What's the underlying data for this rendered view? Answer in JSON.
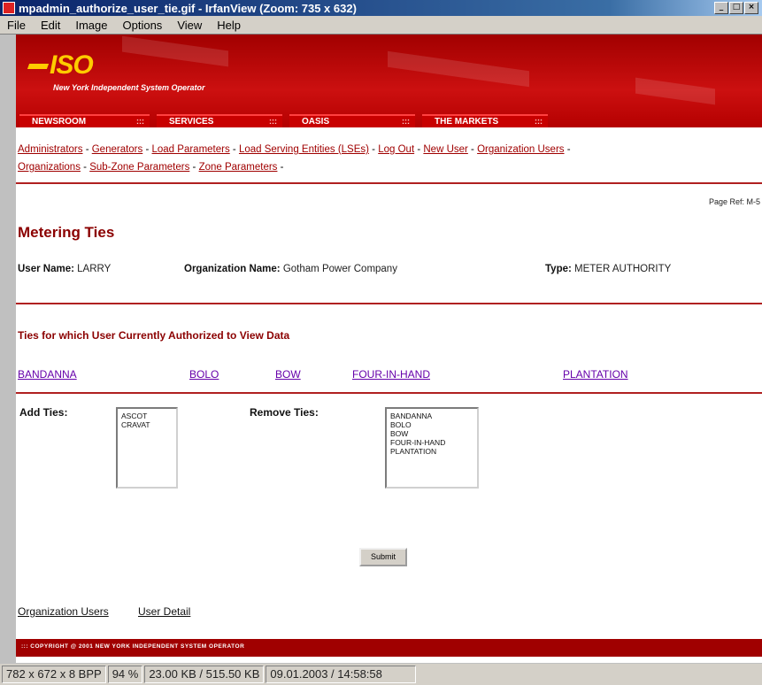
{
  "window": {
    "title": "mpadmin_authorize_user_tie.gif - IrfanView (Zoom: 735 x 632)",
    "buttons": [
      "_",
      "□",
      "×"
    ]
  },
  "menu": [
    "File",
    "Edit",
    "Image",
    "Options",
    "View",
    "Help"
  ],
  "site": {
    "logo": "ISO",
    "tagline": "New York Independent System Operator",
    "nav": [
      "NEWSROOM",
      "SERVICES",
      "OASIS",
      "THE MARKETS"
    ]
  },
  "links": {
    "row1": [
      "Administrators",
      "Generators",
      "Load Parameters",
      "Load Serving Entities (LSEs)",
      "Log Out",
      "New User",
      "Organization Users"
    ],
    "row2": [
      "Organizations",
      "Sub-Zone Parameters",
      "Zone Parameters"
    ],
    "separator": " - "
  },
  "page_ref": "Page Ref: M-5",
  "page_title": "Metering Ties",
  "info": {
    "user_label": "User Name:",
    "user_value": "LARRY",
    "org_label": "Organization Name:",
    "org_value": "Gotham Power Company",
    "type_label": "Type:",
    "type_value": "METER AUTHORITY"
  },
  "section_title": "Ties for which User Currently Authorized to View Data",
  "ties": [
    "BANDANNA",
    "BOLO",
    "BOW",
    "FOUR-IN-HAND",
    "PLANTATION"
  ],
  "add_ties": {
    "label": "Add Ties:",
    "options": [
      "ASCOT",
      "CRAVAT"
    ]
  },
  "remove_ties": {
    "label": "Remove Ties:",
    "options": [
      "BANDANNA",
      "BOLO",
      "BOW",
      "FOUR-IN-HAND",
      "PLANTATION"
    ]
  },
  "submit_label": "Submit",
  "footer_links": [
    "Organization Users",
    "User Detail"
  ],
  "footer_copyright": "::: COPYRIGHT @ 2001 NEW YORK INDEPENDENT SYSTEM OPERATOR",
  "status": [
    "782 x 672 x 8 BPP",
    "94 %",
    "23.00 KB / 515.50 KB",
    "09.01.2003 / 14:58:58"
  ]
}
